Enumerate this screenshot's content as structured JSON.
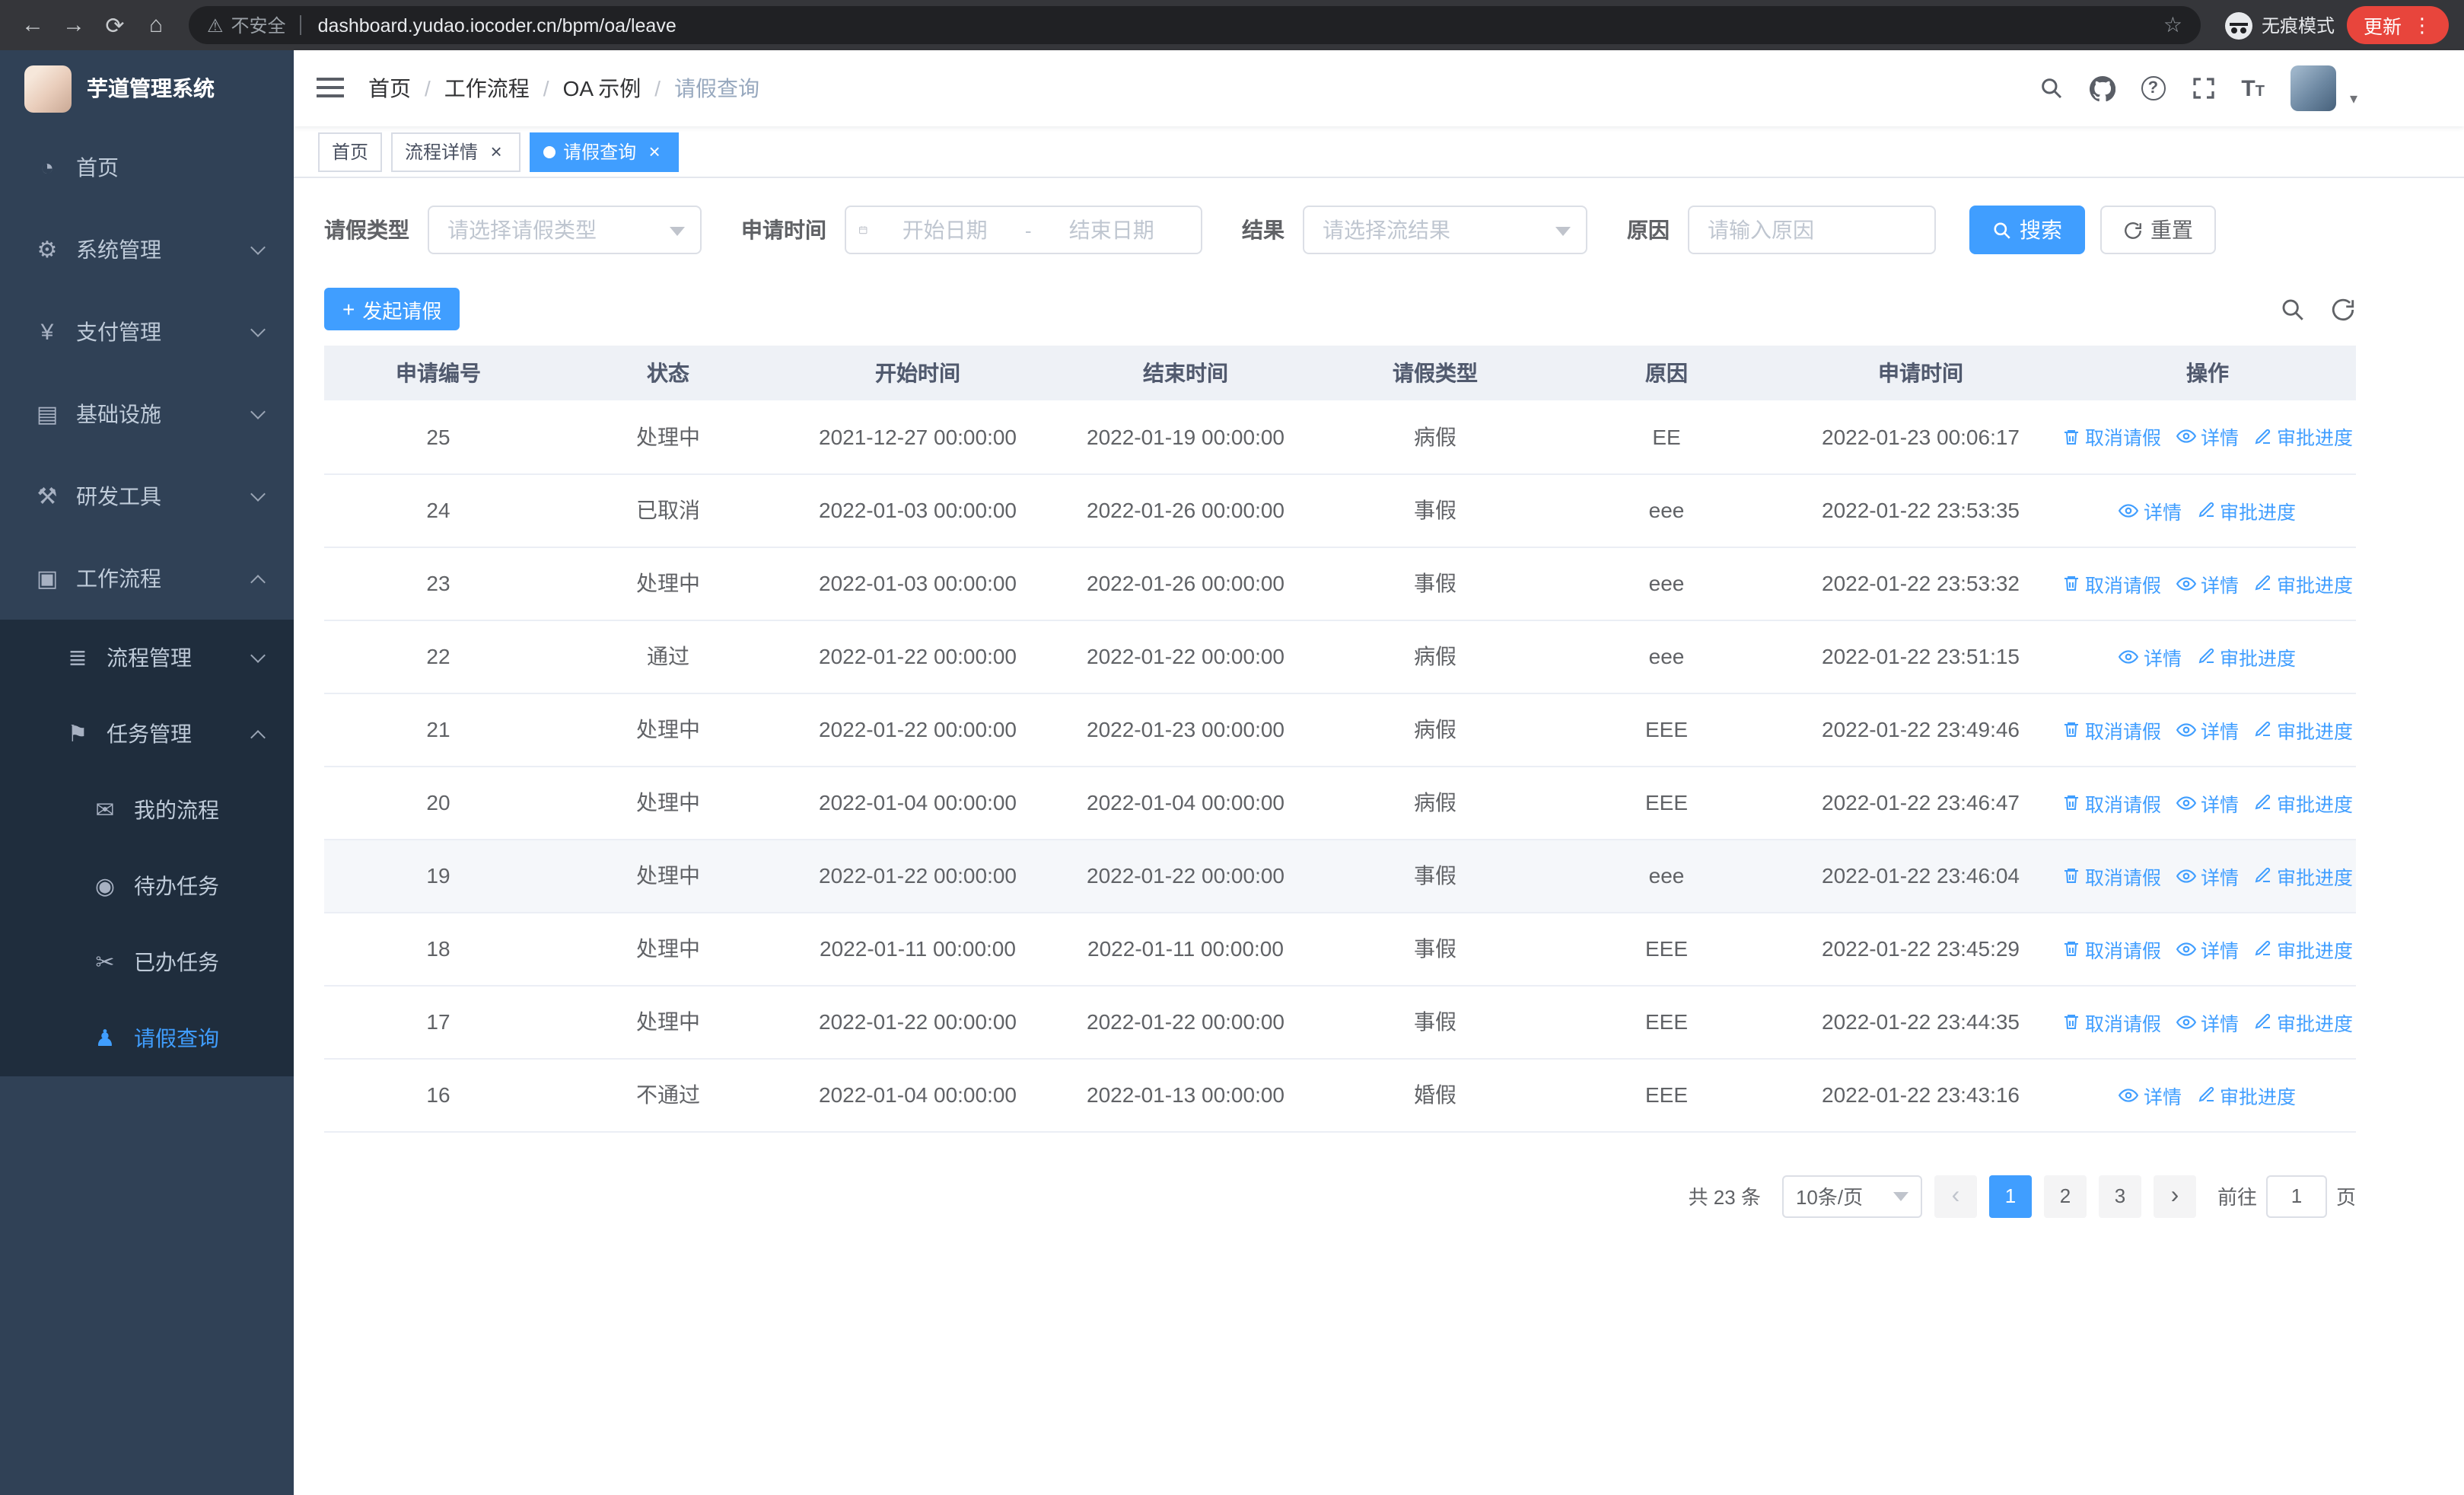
{
  "browser": {
    "security_warning": "不安全",
    "url": "dashboard.yudao.iocoder.cn/bpm/oa/leave",
    "incognito_label": "无痕模式",
    "update_label": "更新"
  },
  "sidebar": {
    "title": "芋道管理系统",
    "items": [
      {
        "label": "首页",
        "icon": "dashboard-icon",
        "level": 1
      },
      {
        "label": "系统管理",
        "icon": "gear-icon",
        "level": 1,
        "chevron": "down"
      },
      {
        "label": "支付管理",
        "icon": "payment-icon",
        "level": 1,
        "chevron": "down"
      },
      {
        "label": "基础设施",
        "icon": "infrastructure-icon",
        "level": 1,
        "chevron": "down"
      },
      {
        "label": "研发工具",
        "icon": "dev-tools-icon",
        "level": 1,
        "chevron": "down"
      },
      {
        "label": "工作流程",
        "icon": "workflow-icon",
        "level": 1,
        "chevron": "up"
      },
      {
        "label": "流程管理",
        "icon": "process-icon",
        "level": 2,
        "chevron": "down"
      },
      {
        "label": "任务管理",
        "icon": "task-icon",
        "level": 2,
        "chevron": "up"
      },
      {
        "label": "我的流程",
        "icon": "my-process-icon",
        "level": 3
      },
      {
        "label": "待办任务",
        "icon": "todo-icon",
        "level": 3
      },
      {
        "label": "已办任务",
        "icon": "done-icon",
        "level": 3
      },
      {
        "label": "请假查询",
        "icon": "leave-query-icon",
        "level": 3,
        "active": true
      }
    ]
  },
  "header": {
    "breadcrumb": [
      "首页",
      "工作流程",
      "OA 示例",
      "请假查询"
    ]
  },
  "tabs": [
    {
      "label": "首页",
      "closable": false,
      "active": false
    },
    {
      "label": "流程详情",
      "closable": true,
      "active": false
    },
    {
      "label": "请假查询",
      "closable": true,
      "active": true
    }
  ],
  "filters": {
    "leave_type_label": "请假类型",
    "leave_type_placeholder": "请选择请假类型",
    "apply_time_label": "申请时间",
    "start_date_placeholder": "开始日期",
    "range_separator": "-",
    "end_date_placeholder": "结束日期",
    "result_label": "结果",
    "result_placeholder": "请选择流结果",
    "reason_label": "原因",
    "reason_placeholder": "请输入原因",
    "search_label": "搜索",
    "reset_label": "重置"
  },
  "toolbar": {
    "create_label": "发起请假"
  },
  "table": {
    "columns": [
      "申请编号",
      "状态",
      "开始时间",
      "结束时间",
      "请假类型",
      "原因",
      "申请时间",
      "操作"
    ],
    "action_labels": {
      "cancel": "取消请假",
      "detail": "详情",
      "progress": "审批进度"
    },
    "rows": [
      {
        "id": "25",
        "status": "处理中",
        "start": "2021-12-27 00:00:00",
        "end": "2022-01-19 00:00:00",
        "type": "病假",
        "reason": "EE",
        "apply_time": "2022-01-23 00:06:17",
        "actions": [
          "cancel",
          "detail",
          "progress"
        ]
      },
      {
        "id": "24",
        "status": "已取消",
        "start": "2022-01-03 00:00:00",
        "end": "2022-01-26 00:00:00",
        "type": "事假",
        "reason": "eee",
        "apply_time": "2022-01-22 23:53:35",
        "actions": [
          "detail",
          "progress"
        ]
      },
      {
        "id": "23",
        "status": "处理中",
        "start": "2022-01-03 00:00:00",
        "end": "2022-01-26 00:00:00",
        "type": "事假",
        "reason": "eee",
        "apply_time": "2022-01-22 23:53:32",
        "actions": [
          "cancel",
          "detail",
          "progress"
        ]
      },
      {
        "id": "22",
        "status": "通过",
        "start": "2022-01-22 00:00:00",
        "end": "2022-01-22 00:00:00",
        "type": "病假",
        "reason": "eee",
        "apply_time": "2022-01-22 23:51:15",
        "actions": [
          "detail",
          "progress"
        ]
      },
      {
        "id": "21",
        "status": "处理中",
        "start": "2022-01-22 00:00:00",
        "end": "2022-01-23 00:00:00",
        "type": "病假",
        "reason": "EEE",
        "apply_time": "2022-01-22 23:49:46",
        "actions": [
          "cancel",
          "detail",
          "progress"
        ]
      },
      {
        "id": "20",
        "status": "处理中",
        "start": "2022-01-04 00:00:00",
        "end": "2022-01-04 00:00:00",
        "type": "病假",
        "reason": "EEE",
        "apply_time": "2022-01-22 23:46:47",
        "actions": [
          "cancel",
          "detail",
          "progress"
        ]
      },
      {
        "id": "19",
        "status": "处理中",
        "start": "2022-01-22 00:00:00",
        "end": "2022-01-22 00:00:00",
        "type": "事假",
        "reason": "eee",
        "apply_time": "2022-01-22 23:46:04",
        "actions": [
          "cancel",
          "detail",
          "progress"
        ],
        "hover": true
      },
      {
        "id": "18",
        "status": "处理中",
        "start": "2022-01-11 00:00:00",
        "end": "2022-01-11 00:00:00",
        "type": "事假",
        "reason": "EEE",
        "apply_time": "2022-01-22 23:45:29",
        "actions": [
          "cancel",
          "detail",
          "progress"
        ]
      },
      {
        "id": "17",
        "status": "处理中",
        "start": "2022-01-22 00:00:00",
        "end": "2022-01-22 00:00:00",
        "type": "事假",
        "reason": "EEE",
        "apply_time": "2022-01-22 23:44:35",
        "actions": [
          "cancel",
          "detail",
          "progress"
        ]
      },
      {
        "id": "16",
        "status": "不通过",
        "start": "2022-01-04 00:00:00",
        "end": "2022-01-13 00:00:00",
        "type": "婚假",
        "reason": "EEE",
        "apply_time": "2022-01-22 23:43:16",
        "actions": [
          "detail",
          "progress"
        ]
      }
    ]
  },
  "pagination": {
    "total_label": "共 23 条",
    "page_size_label": "10条/页",
    "pages": [
      "1",
      "2",
      "3"
    ],
    "active_page": "1",
    "goto_label": "前往",
    "goto_value": "1",
    "page_unit_label": "页"
  },
  "colors": {
    "primary": "#409eff",
    "sidebar_bg": "#304156",
    "submenu_bg": "#1f2d3d",
    "update_pill": "#e8453c"
  }
}
